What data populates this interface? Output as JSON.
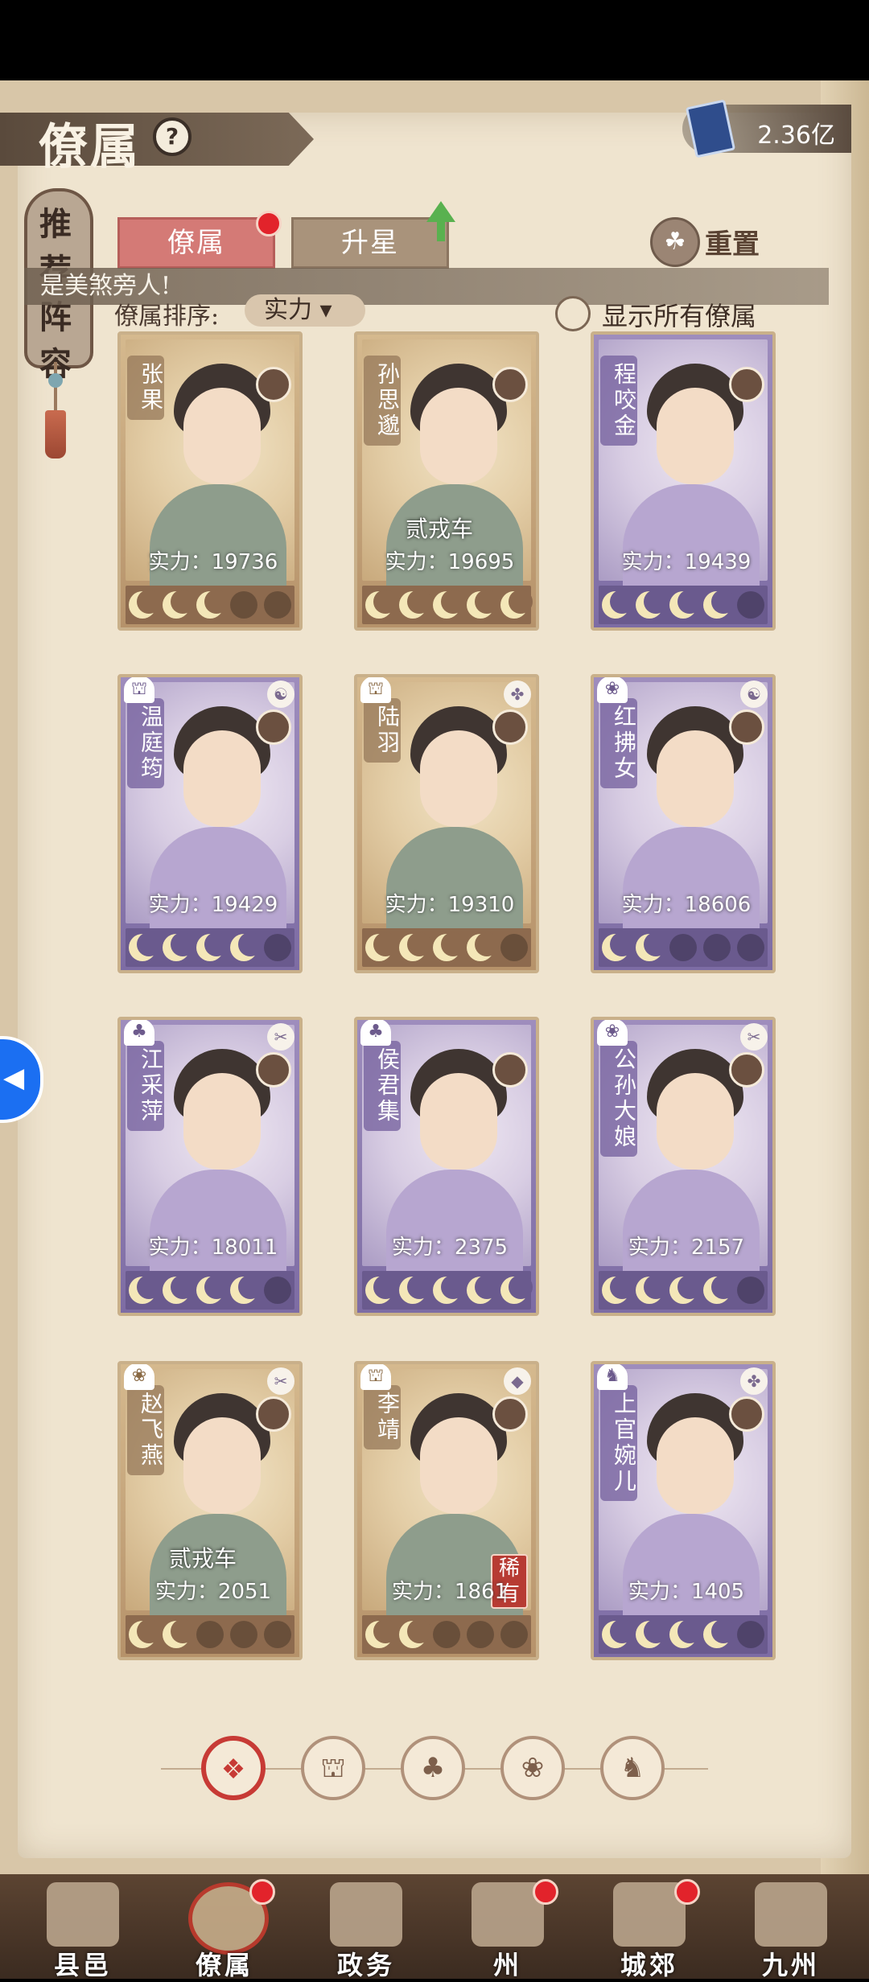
{
  "header": {
    "title": "僚属",
    "help_icon": "?",
    "currency_value": "2.36亿"
  },
  "side_banner": {
    "label": "推荐阵容"
  },
  "tabs": [
    {
      "label": "僚属",
      "active": true
    },
    {
      "label": "升星",
      "active": false
    }
  ],
  "reset_label": "重置",
  "reset_icon": "☘",
  "banner_message": "是美煞旁人!",
  "sort": {
    "label": "僚属排序:",
    "value": "实力 ▾"
  },
  "show_all": {
    "label": "显示所有僚属",
    "checked": false
  },
  "colors": {
    "accent_red": "#c73a35",
    "gold_card": "#c9b08a",
    "purple_card": "#7d6ca4"
  },
  "cards": [
    {
      "name": "张果",
      "power": "实力：19736",
      "title": "",
      "rare": "",
      "rarity": "gold",
      "stars_filled": 3,
      "type_icon": "",
      "skill_icon": ""
    },
    {
      "name": "孙思邈",
      "power": "实力：19695",
      "title": "贰戎车",
      "rare": "",
      "rarity": "gold",
      "stars_filled": 5,
      "type_icon": "",
      "skill_icon": ""
    },
    {
      "name": "程咬金",
      "power": "实力：19439",
      "title": "",
      "rare": "",
      "rarity": "purple",
      "stars_filled": 4,
      "type_icon": "",
      "skill_icon": ""
    },
    {
      "name": "温庭筠",
      "power": "实力：19429",
      "title": "",
      "rare": "",
      "rarity": "purple",
      "stars_filled": 4,
      "type_icon": "⛫",
      "skill_icon": "☯"
    },
    {
      "name": "陆羽",
      "power": "实力：19310",
      "title": "",
      "rare": "",
      "rarity": "gold",
      "stars_filled": 4,
      "type_icon": "⛫",
      "skill_icon": "✤"
    },
    {
      "name": "红拂女",
      "power": "实力：18606",
      "title": "",
      "rare": "",
      "rarity": "purple",
      "stars_filled": 2,
      "type_icon": "❀",
      "skill_icon": "☯"
    },
    {
      "name": "江采萍",
      "power": "实力：18011",
      "title": "",
      "rare": "",
      "rarity": "purple",
      "stars_filled": 4,
      "type_icon": "♣",
      "skill_icon": "✂"
    },
    {
      "name": "侯君集",
      "power": "实力：2375",
      "title": "",
      "rare": "",
      "rarity": "purple",
      "stars_filled": 5,
      "type_icon": "♣",
      "skill_icon": ""
    },
    {
      "name": "公孙大娘",
      "power": "实力：2157",
      "title": "",
      "rare": "",
      "rarity": "purple",
      "stars_filled": 4,
      "type_icon": "❀",
      "skill_icon": "✂"
    },
    {
      "name": "赵飞燕",
      "power": "实力：2051",
      "title": "贰戎车",
      "rare": "",
      "rarity": "gold",
      "stars_filled": 2,
      "type_icon": "❀",
      "skill_icon": "✂"
    },
    {
      "name": "李靖",
      "power": "实力：1861",
      "title": "",
      "rare": "稀有",
      "rarity": "gold",
      "stars_filled": 2,
      "type_icon": "⛫",
      "skill_icon": "◆"
    },
    {
      "name": "上官婉儿",
      "power": "实力：1405",
      "title": "",
      "rare": "",
      "rarity": "purple",
      "stars_filled": 4,
      "type_icon": "♞",
      "skill_icon": "✤"
    }
  ],
  "filters": [
    {
      "icon": "❖",
      "active": true
    },
    {
      "icon": "⛫",
      "active": false
    },
    {
      "icon": "♣",
      "active": false
    },
    {
      "icon": "❀",
      "active": false
    },
    {
      "icon": "♞",
      "active": false
    }
  ],
  "side_handle_icon": "◀",
  "nav": [
    {
      "label": "县邑",
      "active": false,
      "badge": false
    },
    {
      "label": "僚属",
      "active": true,
      "badge": true
    },
    {
      "label": "政务",
      "active": false,
      "badge": false
    },
    {
      "label": "州",
      "active": false,
      "badge": true
    },
    {
      "label": "城郊",
      "active": false,
      "badge": true
    },
    {
      "label": "九州",
      "active": false,
      "badge": false
    }
  ]
}
